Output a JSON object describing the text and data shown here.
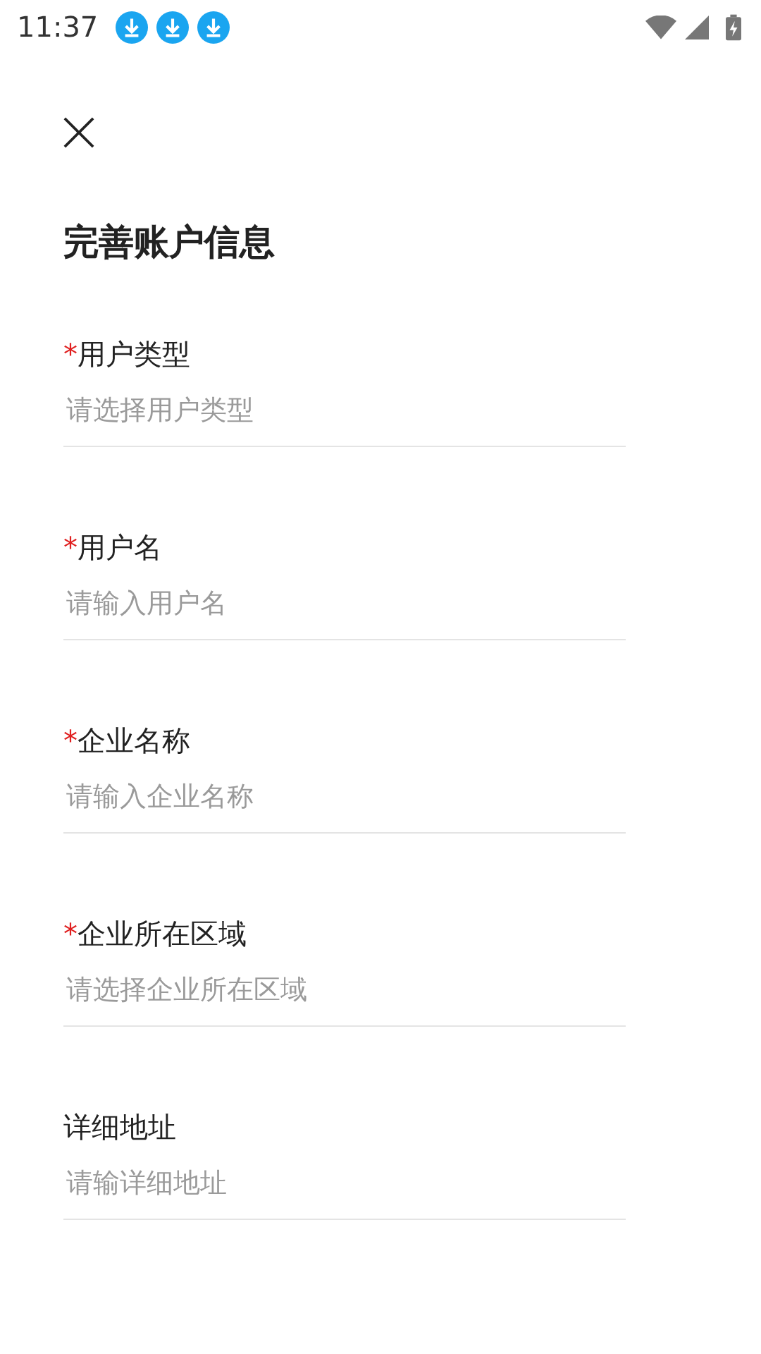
{
  "status_bar": {
    "time": "11:37",
    "notifications": [
      {
        "kind": "download"
      },
      {
        "kind": "download"
      },
      {
        "kind": "download"
      }
    ]
  },
  "title": "完善账户信息",
  "fields": [
    {
      "required_mark": "*",
      "label": "用户类型",
      "placeholder": "请选择用户类型"
    },
    {
      "required_mark": "*",
      "label": "用户名",
      "placeholder": "请输入用户名"
    },
    {
      "required_mark": "*",
      "label": "企业名称",
      "placeholder": "请输入企业名称"
    },
    {
      "required_mark": "*",
      "label": "企业所在区域",
      "placeholder": "请选择企业所在区域"
    },
    {
      "label": "详细地址",
      "placeholder": "请输详细地址"
    }
  ]
}
